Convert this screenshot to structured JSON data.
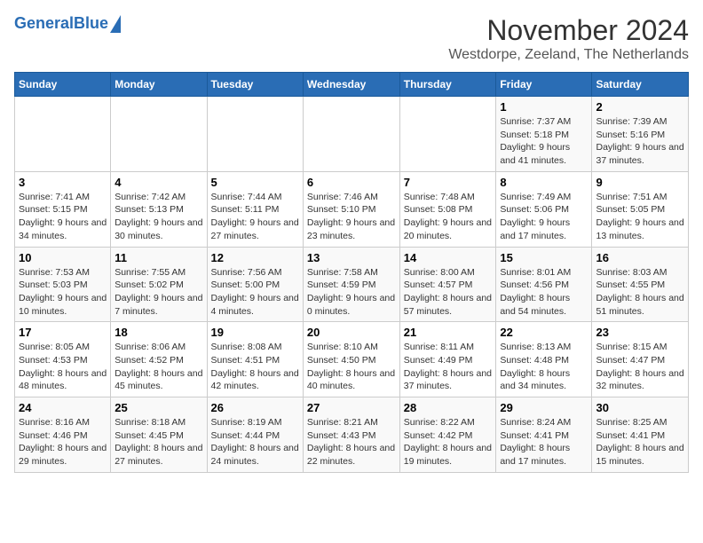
{
  "logo": {
    "text_general": "General",
    "text_blue": "Blue"
  },
  "header": {
    "month": "November 2024",
    "location": "Westdorpe, Zeeland, The Netherlands"
  },
  "weekdays": [
    "Sunday",
    "Monday",
    "Tuesday",
    "Wednesday",
    "Thursday",
    "Friday",
    "Saturday"
  ],
  "weeks": [
    [
      {
        "day": "",
        "info": ""
      },
      {
        "day": "",
        "info": ""
      },
      {
        "day": "",
        "info": ""
      },
      {
        "day": "",
        "info": ""
      },
      {
        "day": "",
        "info": ""
      },
      {
        "day": "1",
        "info": "Sunrise: 7:37 AM\nSunset: 5:18 PM\nDaylight: 9 hours and 41 minutes."
      },
      {
        "day": "2",
        "info": "Sunrise: 7:39 AM\nSunset: 5:16 PM\nDaylight: 9 hours and 37 minutes."
      }
    ],
    [
      {
        "day": "3",
        "info": "Sunrise: 7:41 AM\nSunset: 5:15 PM\nDaylight: 9 hours and 34 minutes."
      },
      {
        "day": "4",
        "info": "Sunrise: 7:42 AM\nSunset: 5:13 PM\nDaylight: 9 hours and 30 minutes."
      },
      {
        "day": "5",
        "info": "Sunrise: 7:44 AM\nSunset: 5:11 PM\nDaylight: 9 hours and 27 minutes."
      },
      {
        "day": "6",
        "info": "Sunrise: 7:46 AM\nSunset: 5:10 PM\nDaylight: 9 hours and 23 minutes."
      },
      {
        "day": "7",
        "info": "Sunrise: 7:48 AM\nSunset: 5:08 PM\nDaylight: 9 hours and 20 minutes."
      },
      {
        "day": "8",
        "info": "Sunrise: 7:49 AM\nSunset: 5:06 PM\nDaylight: 9 hours and 17 minutes."
      },
      {
        "day": "9",
        "info": "Sunrise: 7:51 AM\nSunset: 5:05 PM\nDaylight: 9 hours and 13 minutes."
      }
    ],
    [
      {
        "day": "10",
        "info": "Sunrise: 7:53 AM\nSunset: 5:03 PM\nDaylight: 9 hours and 10 minutes."
      },
      {
        "day": "11",
        "info": "Sunrise: 7:55 AM\nSunset: 5:02 PM\nDaylight: 9 hours and 7 minutes."
      },
      {
        "day": "12",
        "info": "Sunrise: 7:56 AM\nSunset: 5:00 PM\nDaylight: 9 hours and 4 minutes."
      },
      {
        "day": "13",
        "info": "Sunrise: 7:58 AM\nSunset: 4:59 PM\nDaylight: 9 hours and 0 minutes."
      },
      {
        "day": "14",
        "info": "Sunrise: 8:00 AM\nSunset: 4:57 PM\nDaylight: 8 hours and 57 minutes."
      },
      {
        "day": "15",
        "info": "Sunrise: 8:01 AM\nSunset: 4:56 PM\nDaylight: 8 hours and 54 minutes."
      },
      {
        "day": "16",
        "info": "Sunrise: 8:03 AM\nSunset: 4:55 PM\nDaylight: 8 hours and 51 minutes."
      }
    ],
    [
      {
        "day": "17",
        "info": "Sunrise: 8:05 AM\nSunset: 4:53 PM\nDaylight: 8 hours and 48 minutes."
      },
      {
        "day": "18",
        "info": "Sunrise: 8:06 AM\nSunset: 4:52 PM\nDaylight: 8 hours and 45 minutes."
      },
      {
        "day": "19",
        "info": "Sunrise: 8:08 AM\nSunset: 4:51 PM\nDaylight: 8 hours and 42 minutes."
      },
      {
        "day": "20",
        "info": "Sunrise: 8:10 AM\nSunset: 4:50 PM\nDaylight: 8 hours and 40 minutes."
      },
      {
        "day": "21",
        "info": "Sunrise: 8:11 AM\nSunset: 4:49 PM\nDaylight: 8 hours and 37 minutes."
      },
      {
        "day": "22",
        "info": "Sunrise: 8:13 AM\nSunset: 4:48 PM\nDaylight: 8 hours and 34 minutes."
      },
      {
        "day": "23",
        "info": "Sunrise: 8:15 AM\nSunset: 4:47 PM\nDaylight: 8 hours and 32 minutes."
      }
    ],
    [
      {
        "day": "24",
        "info": "Sunrise: 8:16 AM\nSunset: 4:46 PM\nDaylight: 8 hours and 29 minutes."
      },
      {
        "day": "25",
        "info": "Sunrise: 8:18 AM\nSunset: 4:45 PM\nDaylight: 8 hours and 27 minutes."
      },
      {
        "day": "26",
        "info": "Sunrise: 8:19 AM\nSunset: 4:44 PM\nDaylight: 8 hours and 24 minutes."
      },
      {
        "day": "27",
        "info": "Sunrise: 8:21 AM\nSunset: 4:43 PM\nDaylight: 8 hours and 22 minutes."
      },
      {
        "day": "28",
        "info": "Sunrise: 8:22 AM\nSunset: 4:42 PM\nDaylight: 8 hours and 19 minutes."
      },
      {
        "day": "29",
        "info": "Sunrise: 8:24 AM\nSunset: 4:41 PM\nDaylight: 8 hours and 17 minutes."
      },
      {
        "day": "30",
        "info": "Sunrise: 8:25 AM\nSunset: 4:41 PM\nDaylight: 8 hours and 15 minutes."
      }
    ]
  ]
}
